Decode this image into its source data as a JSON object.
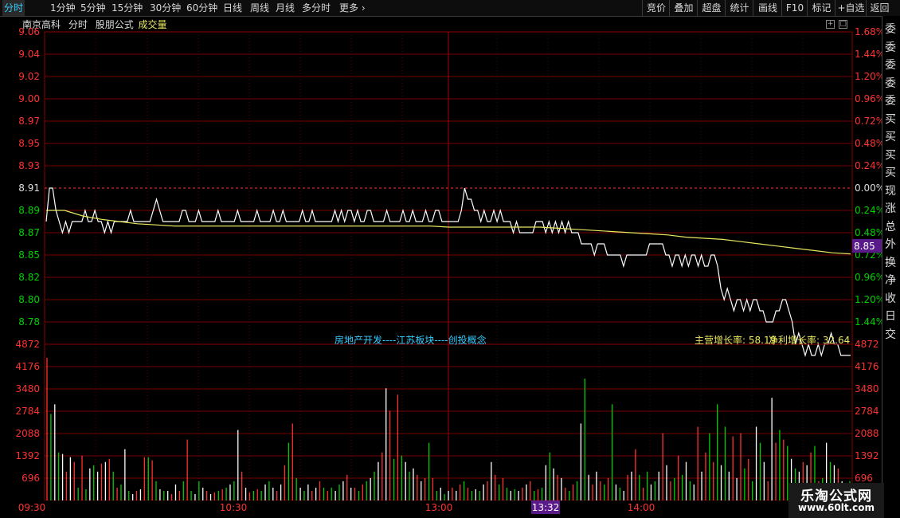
{
  "toolbar": {
    "tabs": [
      "分时",
      "1分钟",
      "5分钟",
      "15分钟",
      "30分钟",
      "60分钟",
      "日线",
      "周线",
      "月线",
      "多分时",
      "更多"
    ],
    "right_buttons": [
      "竞价",
      "叠加",
      "超盘",
      "统计",
      "画线",
      "F10",
      "标记",
      "+自选",
      "返回"
    ]
  },
  "info": {
    "stock_name": "南京高科",
    "mode": "分时",
    "formula": "股朋公式",
    "indicator": "成交量"
  },
  "annotations": {
    "sector": "房地产开发----江苏板块----创投概念",
    "revenue_growth": "主营增长率: 58.19",
    "profit_growth": "净利增长率: 32.64"
  },
  "cursor": {
    "price_label": "8.85",
    "time_label": "13:32"
  },
  "side_text": [
    "委",
    "委",
    "委",
    "委",
    "委",
    "买",
    "买",
    "买",
    "买",
    "现",
    "涨",
    "总",
    "外",
    "换",
    "净",
    "收",
    "日",
    "交"
  ],
  "watermark": {
    "line1": "乐淘公式网",
    "line2": "www.60lt.com"
  },
  "colors": {
    "up": "#ff3232",
    "down": "#00e000",
    "flat": "#ffffff",
    "avg_line": "#e8e860",
    "cursor_bg": "#5a1a8a"
  },
  "chart_data": [
    {
      "type": "line",
      "title": "南京高科 分时",
      "y_ticks_left": [
        "9.06",
        "9.04",
        "9.02",
        "9.00",
        "8.97",
        "8.95",
        "8.93",
        "8.91",
        "8.89",
        "8.87",
        "8.85",
        "8.82",
        "8.80",
        "8.78"
      ],
      "y_ticks_right": [
        "1.68%",
        "1.44%",
        "1.20%",
        "0.96%",
        "0.72%",
        "0.48%",
        "0.24%",
        "0.00%",
        "0.24%",
        "0.48%",
        "0.72%",
        "0.96%",
        "1.20%",
        "1.44%"
      ],
      "x_ticks": [
        "09:30",
        "10:30",
        "13:00",
        "14:00"
      ],
      "prev_close": 8.91,
      "ylim": [
        8.77,
        9.06
      ],
      "series": [
        {
          "name": "price",
          "values": [
            8.88,
            8.91,
            8.91,
            8.89,
            8.88,
            8.87,
            8.88,
            8.87,
            8.88,
            8.88,
            8.88,
            8.88,
            8.89,
            8.88,
            8.88,
            8.89,
            8.88,
            8.88,
            8.87,
            8.88,
            8.87,
            8.88,
            8.88,
            8.88,
            8.88,
            8.88,
            8.89,
            8.88,
            8.88,
            8.88,
            8.88,
            8.88,
            8.88,
            8.89,
            8.9,
            8.89,
            8.88,
            8.88,
            8.88,
            8.88,
            8.88,
            8.88,
            8.89,
            8.89,
            8.88,
            8.88,
            8.88,
            8.89,
            8.88,
            8.88,
            8.88,
            8.88,
            8.88,
            8.89,
            8.88,
            8.88,
            8.88,
            8.88,
            8.88,
            8.89,
            8.88,
            8.88,
            8.88,
            8.88,
            8.88,
            8.89,
            8.88,
            8.88,
            8.88,
            8.88,
            8.89,
            8.88,
            8.88,
            8.89,
            8.88,
            8.88,
            8.88,
            8.88,
            8.88,
            8.89,
            8.88,
            8.88,
            8.89,
            8.88,
            8.88,
            8.88,
            8.88,
            8.88,
            8.88,
            8.89,
            8.88,
            8.89,
            8.88,
            8.89,
            8.89,
            8.88,
            8.89,
            8.88,
            8.88,
            8.89,
            8.89,
            8.88,
            8.88,
            8.88,
            8.88,
            8.89,
            8.88,
            8.88,
            8.88,
            8.88,
            8.89,
            8.88,
            8.88,
            8.89,
            8.88,
            8.88,
            8.88,
            8.89,
            8.88,
            8.88,
            8.89,
            8.89,
            8.88,
            8.88,
            8.88,
            8.88,
            8.88,
            8.88,
            8.89,
            8.91,
            8.9,
            8.9,
            8.89,
            8.89,
            8.88,
            8.89,
            8.88,
            8.88,
            8.89,
            8.88,
            8.89,
            8.88,
            8.88,
            8.88,
            8.87,
            8.88,
            8.87,
            8.87,
            8.87,
            8.87,
            8.87,
            8.88,
            8.88,
            8.88,
            8.87,
            8.88,
            8.87,
            8.88,
            8.87,
            8.88,
            8.87,
            8.88,
            8.87,
            8.87,
            8.87,
            8.86,
            8.86,
            8.86,
            8.86,
            8.85,
            8.86,
            8.86,
            8.86,
            8.85,
            8.85,
            8.85,
            8.85,
            8.85,
            8.84,
            8.85,
            8.85,
            8.85,
            8.85,
            8.85,
            8.85,
            8.85,
            8.86,
            8.86,
            8.86,
            8.86,
            8.86,
            8.85,
            8.85,
            8.84,
            8.85,
            8.85,
            8.84,
            8.85,
            8.84,
            8.85,
            8.85,
            8.84,
            8.85,
            8.84,
            8.84,
            8.85,
            8.85,
            8.84,
            8.82,
            8.81,
            8.82,
            8.81,
            8.8,
            8.81,
            8.81,
            8.8,
            8.81,
            8.8,
            8.81,
            8.81,
            8.8,
            8.8,
            8.79,
            8.79,
            8.79,
            8.8,
            8.8,
            8.81,
            8.81,
            8.8,
            8.79,
            8.77,
            8.78,
            8.77,
            8.76,
            8.77,
            8.76,
            8.76,
            8.77,
            8.76,
            8.77,
            8.77,
            8.78,
            8.77,
            8.77,
            8.76,
            8.76,
            8.76,
            8.76
          ]
        },
        {
          "name": "average",
          "values": [
            8.89,
            8.89,
            8.885,
            8.882,
            8.88,
            8.878,
            8.877,
            8.876,
            8.876,
            8.876,
            8.876,
            8.876,
            8.876,
            8.876,
            8.876,
            8.876,
            8.876,
            8.876,
            8.876,
            8.876,
            8.876,
            8.876,
            8.875,
            8.875,
            8.875,
            8.875,
            8.875,
            8.875,
            8.874,
            8.873,
            8.872,
            8.871,
            8.87,
            8.869,
            8.868,
            8.866,
            8.865,
            8.864,
            8.862,
            8.86,
            8.858,
            8.856,
            8.854,
            8.852,
            8.851
          ]
        }
      ]
    },
    {
      "type": "bar",
      "title": "成交量",
      "y_ticks": [
        "4872",
        "4176",
        "3480",
        "2784",
        "2088",
        "1392",
        "696"
      ],
      "ylim": [
        0,
        4872
      ],
      "series": [
        {
          "name": "volume",
          "values": [
            4450,
            2700,
            3000,
            1500,
            1450,
            900,
            1350,
            1200,
            400,
            1400,
            350,
            1000,
            1100,
            900,
            1150,
            1200,
            1300,
            900,
            400,
            500,
            1600,
            300,
            200,
            300,
            350,
            1350,
            1350,
            1250,
            600,
            350,
            300,
            300,
            200,
            500,
            300,
            600,
            1900,
            300,
            200,
            600,
            400,
            300,
            200,
            250,
            300,
            350,
            400,
            500,
            600,
            2200,
            900,
            400,
            250,
            300,
            350,
            300,
            500,
            600,
            400,
            300,
            500,
            1100,
            1800,
            2400,
            700,
            400,
            300,
            500,
            300,
            400,
            600,
            400,
            300,
            400,
            300,
            500,
            600,
            800,
            400,
            400,
            300,
            500,
            600,
            700,
            900,
            1200,
            1500,
            3500,
            2800,
            1300,
            3300,
            1400,
            1200,
            900,
            1000,
            800,
            600,
            700,
            1800,
            700,
            300,
            400,
            200,
            300,
            400,
            300,
            500,
            600,
            400,
            300,
            350,
            300,
            500,
            600,
            1200,
            800,
            500,
            700,
            400,
            300,
            350,
            300,
            400,
            500,
            600,
            300,
            350,
            400,
            1100,
            1500,
            1000,
            800,
            700,
            400,
            300,
            500,
            600,
            2400,
            3800,
            800,
            500,
            900,
            600,
            500,
            700,
            3000,
            500,
            400,
            300,
            800,
            900,
            1600,
            800,
            400,
            900,
            500,
            600,
            900,
            2100,
            1100,
            600,
            700,
            1400,
            800,
            1200,
            600,
            500,
            2300,
            900,
            1500,
            2100,
            1200,
            3000,
            1100,
            2300,
            900,
            2000,
            700,
            2100,
            1000,
            1300,
            600,
            2300,
            1800,
            1200,
            600,
            3200,
            1800,
            2200,
            1900,
            1700,
            1300,
            1000,
            900,
            1200,
            1100,
            1500,
            1700,
            600,
            700,
            1800,
            1200,
            1100,
            1000,
            600,
            500,
            600
          ]
        }
      ],
      "colors_pattern": "mixed up/down/flat"
    }
  ]
}
